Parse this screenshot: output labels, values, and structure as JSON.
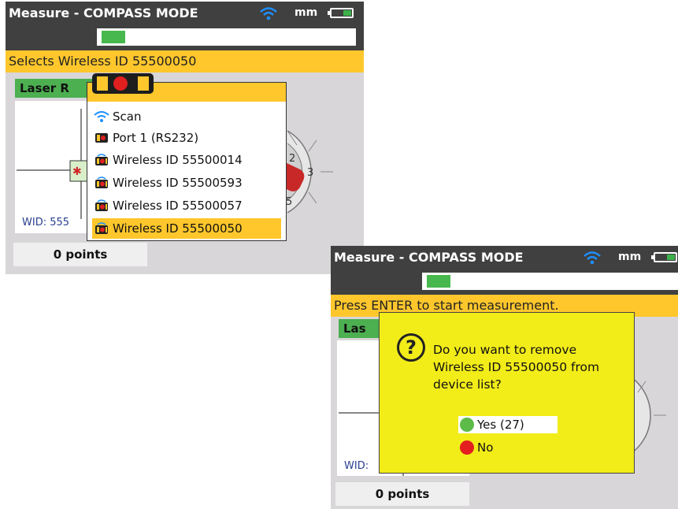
{
  "screen1": {
    "title": "Measure - COMPASS MODE",
    "unit": "mm",
    "status": "Selects Wireless ID 55500050",
    "green_label": "Laser R",
    "wid_label": "WID: 555",
    "points": "0 points",
    "dropdown": {
      "items": [
        {
          "label": "Scan",
          "icon": "wifi-icon"
        },
        {
          "label": "Port 1 (RS232)",
          "icon": "sensor-port-icon"
        },
        {
          "label": "Wireless ID 55500014",
          "icon": "wireless-sensor-icon"
        },
        {
          "label": "Wireless ID 55500593",
          "icon": "wireless-sensor-icon"
        },
        {
          "label": "Wireless ID 55500057",
          "icon": "wireless-sensor-icon"
        },
        {
          "label": "Wireless ID 55500050",
          "icon": "wireless-sensor-icon",
          "selected": true
        }
      ]
    },
    "compass_labels": [
      "2",
      "3",
      "5"
    ]
  },
  "screen2": {
    "title": "Measure - COMPASS MODE",
    "unit": "mm",
    "status": "Press ENTER to start measurement.",
    "green_label": "Las",
    "wid_label": "WID:",
    "points": "0 points",
    "dialog": {
      "icon": "?",
      "message": "Do you want to remove Wireless ID 55500050 from device list?",
      "yes_label": "Yes (27)",
      "no_label": "No"
    }
  },
  "colors": {
    "titlebar": "#404040",
    "status": "#ffc72c",
    "green": "#4caf50",
    "dialog": "#f2ec19",
    "wifi": "#1e8fff"
  }
}
